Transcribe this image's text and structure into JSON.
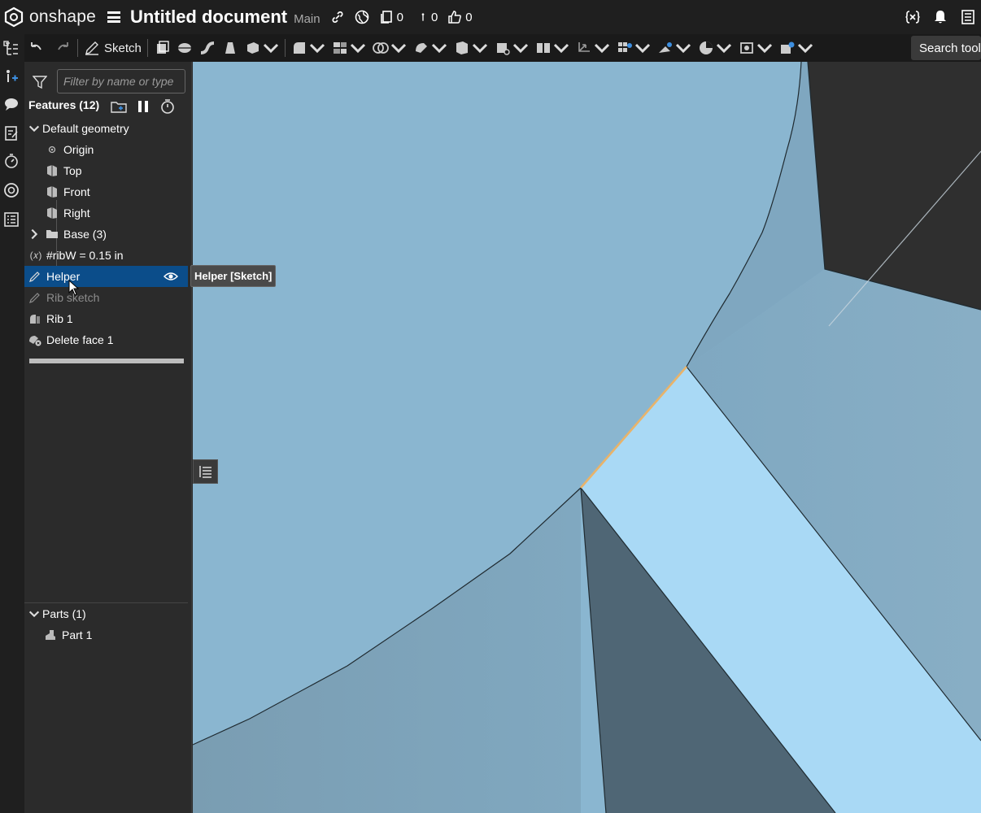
{
  "app": {
    "name": "onshape"
  },
  "document": {
    "title": "Untitled document",
    "branch": "Main"
  },
  "topbar": {
    "versions_count": "0",
    "branches_count": "0",
    "likes_count": "0"
  },
  "toolbar": {
    "sketch_label": "Sketch",
    "search_label": "Search tools"
  },
  "features": {
    "filter_placeholder": "Filter by name or type",
    "header": "Features (12)",
    "items": [
      {
        "label": "Default geometry",
        "kind": "group-open"
      },
      {
        "label": "Origin",
        "kind": "origin"
      },
      {
        "label": "Top",
        "kind": "plane"
      },
      {
        "label": "Front",
        "kind": "plane"
      },
      {
        "label": "Right",
        "kind": "plane"
      },
      {
        "label": "Base (3)",
        "kind": "folder"
      },
      {
        "label": "#ribW = 0.15 in",
        "kind": "variable"
      },
      {
        "label": "Helper",
        "kind": "sketch",
        "selected": true
      },
      {
        "label": "Rib sketch",
        "kind": "sketch",
        "suppressed": true
      },
      {
        "label": "Rib 1",
        "kind": "rib"
      },
      {
        "label": "Delete face 1",
        "kind": "delete-face"
      }
    ]
  },
  "parts": {
    "header": "Parts (1)",
    "items": [
      {
        "label": "Part 1"
      }
    ]
  },
  "tooltip": {
    "text": "Helper [Sketch]"
  },
  "colors": {
    "selection": "#0b4d8a",
    "face_light": "#a9d9f5",
    "face_mid": "#8ab6d0",
    "face_dark": "#4f6675",
    "edge_highlight": "#e8b36a"
  }
}
